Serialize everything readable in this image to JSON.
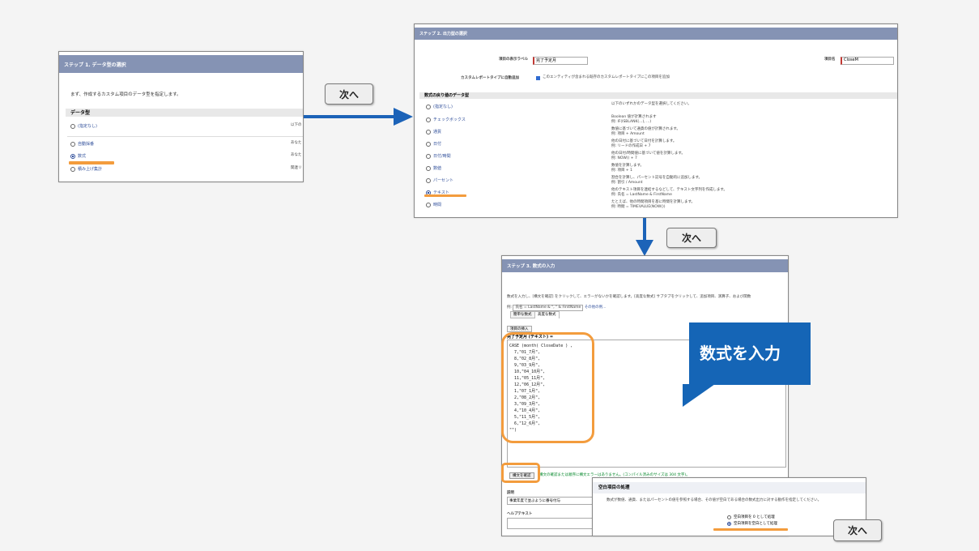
{
  "next_label": "次へ",
  "step1": {
    "title": "ステップ 1. データ型の選択",
    "instruction": "まず、作成するカスタム項目のデータ型を指定します。",
    "section": "データ型",
    "options": [
      {
        "label": "(指定なし)",
        "desc": "以下の"
      },
      {
        "label": "自動採番",
        "desc": "あなた"
      },
      {
        "label": "数式",
        "desc": "あなた"
      },
      {
        "label": "積み上げ集計",
        "desc": "関連リ"
      }
    ]
  },
  "step2": {
    "title": "ステップ 2. 出力型の選択",
    "label_caption": "項目の表示ラベル",
    "label_value": "完了予定月",
    "name_caption": "項目名",
    "name_value": "CloseM",
    "checkbox_caption": "カスタムレポートタイプに自動追加",
    "checkbox_text": "このエンティティが含まれる既存のカスタムレポートタイプにこの項目を追加",
    "section": "数式の戻り値のデータ型",
    "types": [
      {
        "label": "(指定なし)",
        "desc1": "以下のいずれかのデータ型を選択してください。",
        "desc2": ""
      },
      {
        "label": "チェックボックス",
        "desc1": "Boolean 値が計算されます",
        "desc2": "例: IF(ISBLANK(...), ...)"
      },
      {
        "label": "通貨",
        "desc1": "数値に基づいて通貨の値が計算されます。",
        "desc2": "例: 項目 + Amount"
      },
      {
        "label": "日付",
        "desc1": "他の日付に基づいて日付を計算します。",
        "desc2": "例: リードの作成日 + 7"
      },
      {
        "label": "日付/時間",
        "desc1": "他の日付/時間値に基づいて値を計算します。",
        "desc2": "例: NOW() + 7"
      },
      {
        "label": "数値",
        "desc1": "数値を計算します。",
        "desc2": "例: 項目 + 1"
      },
      {
        "label": "パーセント",
        "desc1": "割合を計算し、パーセント記号を自動的に追加します。",
        "desc2": "例: 割引 / Amount"
      },
      {
        "label": "テキスト",
        "desc1": "他のテキスト項目を連結するなどして、テキスト文字列を作成します。",
        "desc2": "例: 氏名 = LastName & FirstName"
      },
      {
        "label": "時間",
        "desc1": "たとえば、他の時間項目を基に時間を計算します。",
        "desc2": "例: 時間 = TIMEVALUE(NOW())"
      }
    ]
  },
  "step3": {
    "title": "ステップ 3. 数式の入力",
    "intro": "数式を入力し、[構文を確認] をクリックして、エラーがないかを確認します。[高度な数式] サブタブをクリックして、追加項目、演算子、および関数",
    "example_prefix": "例:",
    "example_code": "氏名 = LastName & \", \" & FirstName",
    "example_more": "その他の例...",
    "tab_simple": "簡単な数式",
    "tab_advanced": "高度な数式",
    "insert_field": "項目の挿入",
    "formula_header": "完了予定月 (テキスト) =",
    "formula_lines": [
      "CASE (month( CloseDate ) ,",
      "  7,\"01_7月\",",
      "  8,\"02_8月\",",
      "  9,\"03_9月\",",
      "  10,\"04_10月\",",
      "  11,\"05_11月\",",
      "  12,\"06_12月\",",
      "  1,\"07_1月\",",
      "  2,\"08_2月\",",
      "  3,\"09_3月\",",
      "  4,\"10_4月\",",
      "  5,\"11_5月\",",
      "  6,\"12_6月\",",
      "\"\")"
    ],
    "check_syntax": "構文を確認",
    "syntax_result": "構文の確認または順序に構文エラーはありません。(コンパイル済みのサイズは 304 文字)。",
    "description_label": "説明",
    "description_value": "事業年度で並ぶように番号付与",
    "help_label": "ヘルプテキスト"
  },
  "callout": "数式を入力",
  "blank": {
    "title": "空白項目の処理",
    "text": "数式が数値、通貨、またはパーセントの値を参照する場合、その値が空白である場合の数式出力に対する動作を指定してください。",
    "option1": "空白項目を 0 として処理",
    "option2": "空白項目を空白として処理"
  },
  "colors": {
    "header": "#8593b4",
    "arrow": "#1c63b8",
    "highlight": "#f39c3d",
    "callout": "#1565b6"
  }
}
